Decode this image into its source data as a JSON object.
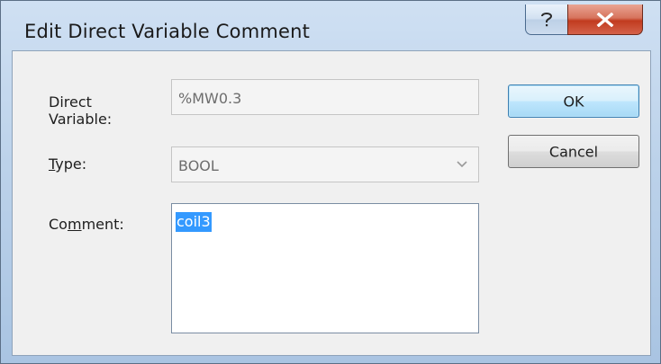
{
  "window": {
    "title": "Edit Direct Variable Comment"
  },
  "titlebar_buttons": {
    "help_icon": "question-mark-icon",
    "close_icon": "x-close-icon"
  },
  "form": {
    "direct_variable": {
      "label_line1": "Direct",
      "label_line2": "Variable:",
      "value": "%MW0.3"
    },
    "type": {
      "label_first": "T",
      "label_rest": "ype:",
      "value": "BOOL"
    },
    "comment": {
      "label_pre": "Co",
      "label_accel": "m",
      "label_post": "ment:",
      "value": "coil3"
    }
  },
  "buttons": {
    "ok": "OK",
    "cancel": "Cancel"
  }
}
